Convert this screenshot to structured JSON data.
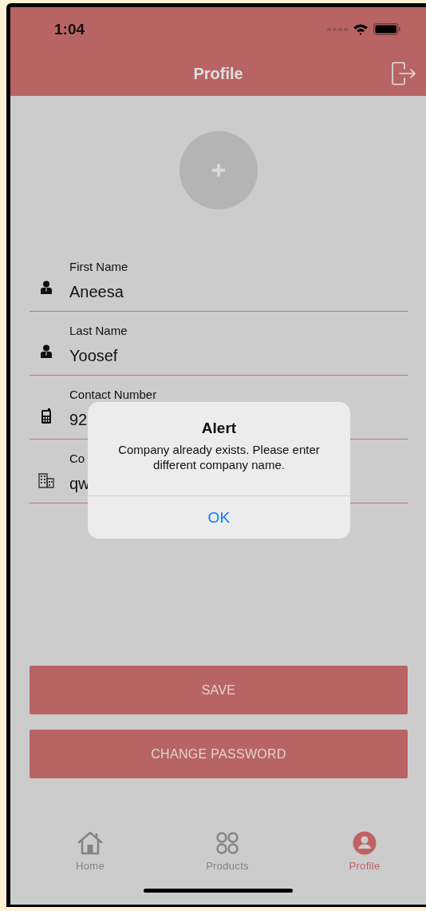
{
  "status_bar": {
    "time": "1:04"
  },
  "header": {
    "title": "Profile"
  },
  "fields": [
    {
      "kind": "person",
      "label": "First Name",
      "value": "Aneesa"
    },
    {
      "kind": "person",
      "label": "Last Name",
      "value": "Yoosef"
    },
    {
      "kind": "phone",
      "label": "Contact Number",
      "value": "92"
    },
    {
      "kind": "building",
      "label": "Co",
      "value": "qw"
    }
  ],
  "buttons": [
    "SAVE",
    "CHANGE PASSWORD"
  ],
  "tabs": [
    {
      "kind": "home",
      "label": "Home",
      "selected": false
    },
    {
      "kind": "grid",
      "label": "Products",
      "selected": false
    },
    {
      "kind": "profile",
      "label": "Profile",
      "selected": true
    }
  ],
  "alert": {
    "title": "Alert",
    "message": "Company already exists. Please enter different company name.",
    "button": "OK"
  }
}
